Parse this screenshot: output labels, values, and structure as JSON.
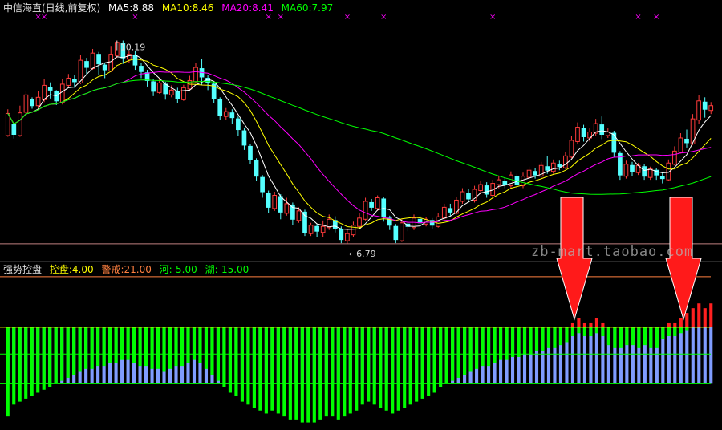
{
  "header": {
    "title": "中信海直(日线,前复权)",
    "ma5": "MA5:8.88",
    "ma10": "MA10:8.46",
    "ma20": "MA20:8.41",
    "ma60": "MA60:7.97",
    "colors": {
      "title": "#e0e0e0",
      "ma5": "#ffffff",
      "ma10": "#ffff00",
      "ma20": "#ff00ff",
      "ma60": "#00ff00"
    }
  },
  "indicator_header": {
    "name": "强势控盘",
    "kongpan": "控盘:4.00",
    "jingjie": "警戒:21.00",
    "he": "河:-5.00",
    "hu": "湖:-15.00",
    "colors": {
      "name": "#e0e0e0",
      "kongpan": "#ffff00",
      "jingjie": "#ff8040",
      "he": "#00ff00",
      "hu": "#00ff00"
    }
  },
  "watermark": "zb-mart.taobao.com",
  "chart_data": [
    {
      "type": "candlestick",
      "title": "中信海直(日线,前复权)",
      "annotations": [
        {
          "label": "10.19",
          "kind": "high"
        },
        {
          "label": "6.79",
          "kind": "low"
        }
      ],
      "ylim": [
        6.6,
        10.6
      ],
      "reference_line": 6.79,
      "candles": [
        [
          8.6,
          8.97,
          8.58,
          9.04
        ],
        [
          8.79,
          8.62,
          8.55,
          8.8
        ],
        [
          8.6,
          8.98,
          8.58,
          9.1
        ],
        [
          8.99,
          9.28,
          8.97,
          9.35
        ],
        [
          9.2,
          9.1,
          9.05,
          9.24
        ],
        [
          9.1,
          9.24,
          9.06,
          9.34
        ],
        [
          9.2,
          9.44,
          9.16,
          9.55
        ],
        [
          9.4,
          9.36,
          9.22,
          9.49
        ],
        [
          9.34,
          9.18,
          9.11,
          9.36
        ],
        [
          9.15,
          9.46,
          9.12,
          9.55
        ],
        [
          9.44,
          9.56,
          9.4,
          9.63
        ],
        [
          9.54,
          9.5,
          9.4,
          9.61
        ],
        [
          9.48,
          9.86,
          9.46,
          9.95
        ],
        [
          9.84,
          9.74,
          9.62,
          9.9
        ],
        [
          9.72,
          9.98,
          9.7,
          10.05
        ],
        [
          9.96,
          9.8,
          9.62,
          10.0
        ],
        [
          9.78,
          9.7,
          9.56,
          9.82
        ],
        [
          9.68,
          9.96,
          9.66,
          10.1
        ],
        [
          9.94,
          10.16,
          9.9,
          10.19
        ],
        [
          10.14,
          9.9,
          9.8,
          10.19
        ],
        [
          9.88,
          9.96,
          9.82,
          10.02
        ],
        [
          9.94,
          9.78,
          9.7,
          10.02
        ],
        [
          9.76,
          9.67,
          9.56,
          9.82
        ],
        [
          9.65,
          9.52,
          9.42,
          9.7
        ],
        [
          9.5,
          9.34,
          9.26,
          9.55
        ],
        [
          9.32,
          9.48,
          9.3,
          9.56
        ],
        [
          9.46,
          9.3,
          9.2,
          9.5
        ],
        [
          9.28,
          9.36,
          9.24,
          9.44
        ],
        [
          9.34,
          9.22,
          9.15,
          9.4
        ],
        [
          9.2,
          9.4,
          9.18,
          9.45
        ],
        [
          9.38,
          9.52,
          9.34,
          9.6
        ],
        [
          9.5,
          9.74,
          9.48,
          9.82
        ],
        [
          9.72,
          9.58,
          9.44,
          9.88
        ],
        [
          9.56,
          9.48,
          9.36,
          9.62
        ],
        [
          9.46,
          9.22,
          9.14,
          9.5
        ],
        [
          9.2,
          8.94,
          8.86,
          9.24
        ],
        [
          8.92,
          9.0,
          8.86,
          9.06
        ],
        [
          8.98,
          8.9,
          8.8,
          9.04
        ],
        [
          8.88,
          8.7,
          8.6,
          8.92
        ],
        [
          8.68,
          8.44,
          8.36,
          8.72
        ],
        [
          8.42,
          8.2,
          8.12,
          8.46
        ],
        [
          8.18,
          7.92,
          7.84,
          8.22
        ],
        [
          7.9,
          7.66,
          7.56,
          7.94
        ],
        [
          7.64,
          7.4,
          7.3,
          7.68
        ],
        [
          7.38,
          7.6,
          7.34,
          7.66
        ],
        [
          7.58,
          7.32,
          7.2,
          7.62
        ],
        [
          7.3,
          7.46,
          7.26,
          7.56
        ],
        [
          7.44,
          7.2,
          7.1,
          7.48
        ],
        [
          7.18,
          7.34,
          7.14,
          7.4
        ],
        [
          7.32,
          6.98,
          6.92,
          7.36
        ],
        [
          6.96,
          7.1,
          6.92,
          7.14
        ],
        [
          7.08,
          7.0,
          6.9,
          7.12
        ],
        [
          6.98,
          7.08,
          6.9,
          7.18
        ],
        [
          7.06,
          7.2,
          7.02,
          7.28
        ],
        [
          7.18,
          7.05,
          6.98,
          7.25
        ],
        [
          7.03,
          6.86,
          6.8,
          7.08
        ],
        [
          6.84,
          6.96,
          6.79,
          7.04
        ],
        [
          6.94,
          7.1,
          6.9,
          7.16
        ],
        [
          7.08,
          7.22,
          7.04,
          7.3
        ],
        [
          7.2,
          7.5,
          7.18,
          7.56
        ],
        [
          7.48,
          7.4,
          7.34,
          7.54
        ],
        [
          7.38,
          7.56,
          7.34,
          7.6
        ],
        [
          7.54,
          7.24,
          7.16,
          7.58
        ],
        [
          7.22,
          7.1,
          7.02,
          7.26
        ],
        [
          7.08,
          6.86,
          6.8,
          7.12
        ],
        [
          6.84,
          7.14,
          6.82,
          7.2
        ],
        [
          7.12,
          7.08,
          7.0,
          7.16
        ],
        [
          7.06,
          7.22,
          7.02,
          7.28
        ],
        [
          7.2,
          7.14,
          7.08,
          7.26
        ],
        [
          7.12,
          7.2,
          7.08,
          7.24
        ],
        [
          7.18,
          7.1,
          7.04,
          7.22
        ],
        [
          7.08,
          7.24,
          7.06,
          7.3
        ],
        [
          7.22,
          7.4,
          7.2,
          7.46
        ],
        [
          7.38,
          7.32,
          7.26,
          7.46
        ],
        [
          7.3,
          7.52,
          7.28,
          7.58
        ],
        [
          7.5,
          7.66,
          7.46,
          7.72
        ],
        [
          7.64,
          7.54,
          7.48,
          7.7
        ],
        [
          7.52,
          7.7,
          7.48,
          7.76
        ],
        [
          7.68,
          7.78,
          7.62,
          7.84
        ],
        [
          7.76,
          7.62,
          7.56,
          7.82
        ],
        [
          7.6,
          7.8,
          7.58,
          7.86
        ],
        [
          7.78,
          7.86,
          7.72,
          7.92
        ],
        [
          7.84,
          7.78,
          7.72,
          7.9
        ],
        [
          7.76,
          7.94,
          7.72,
          8.0
        ],
        [
          7.92,
          7.78,
          7.7,
          7.96
        ],
        [
          7.76,
          7.92,
          7.72,
          7.98
        ],
        [
          7.9,
          8.02,
          7.86,
          8.08
        ],
        [
          8.0,
          7.94,
          7.88,
          8.06
        ],
        [
          7.92,
          8.1,
          7.88,
          8.16
        ],
        [
          8.08,
          8.02,
          7.96,
          8.26
        ],
        [
          8.0,
          8.14,
          7.96,
          8.2
        ],
        [
          8.12,
          8.08,
          8.02,
          8.18
        ],
        [
          8.06,
          8.26,
          8.04,
          8.32
        ],
        [
          8.24,
          8.52,
          8.22,
          8.6
        ],
        [
          8.5,
          8.74,
          8.46,
          8.82
        ],
        [
          8.72,
          8.58,
          8.5,
          8.78
        ],
        [
          8.56,
          8.66,
          8.5,
          8.72
        ],
        [
          8.64,
          8.8,
          8.6,
          8.88
        ],
        [
          8.78,
          8.62,
          8.54,
          8.92
        ],
        [
          8.6,
          8.66,
          8.56,
          8.72
        ],
        [
          8.64,
          8.32,
          8.24,
          8.68
        ],
        [
          8.3,
          7.94,
          7.86,
          8.34
        ],
        [
          7.92,
          8.12,
          7.88,
          8.18
        ],
        [
          8.1,
          8.0,
          7.92,
          8.16
        ],
        [
          7.98,
          8.1,
          7.94,
          8.14
        ],
        [
          8.08,
          7.92,
          7.86,
          8.12
        ],
        [
          7.9,
          8.04,
          7.86,
          8.08
        ],
        [
          8.02,
          7.94,
          7.86,
          8.06
        ],
        [
          7.92,
          7.88,
          7.8,
          7.98
        ],
        [
          7.86,
          8.14,
          7.84,
          8.2
        ],
        [
          8.12,
          8.34,
          8.1,
          8.42
        ],
        [
          8.32,
          8.56,
          8.3,
          8.64
        ],
        [
          8.54,
          8.48,
          8.4,
          8.7
        ],
        [
          8.46,
          8.88,
          8.44,
          8.96
        ],
        [
          8.86,
          9.18,
          8.8,
          9.28
        ],
        [
          9.16,
          9.04,
          8.9,
          9.24
        ],
        [
          9.02,
          9.1,
          8.96,
          9.16
        ]
      ],
      "ma_series": [
        {
          "name": "MA5",
          "period": 5,
          "color": "#ffffff"
        },
        {
          "name": "MA10",
          "period": 10,
          "color": "#ffff00"
        },
        {
          "name": "MA20",
          "period": 20,
          "color": "#ff00ff"
        },
        {
          "name": "MA60",
          "period": 60,
          "color": "#00ff00"
        }
      ],
      "signal_marks": {
        "symbol": "×",
        "color": "#ff00ff",
        "indices": [
          5,
          6,
          21,
          43,
          45,
          56,
          62,
          80,
          104,
          107
        ]
      }
    },
    {
      "type": "bar",
      "title": "强势控盘",
      "ylim": [
        -30,
        25
      ],
      "reference_lines": [
        {
          "name": "警戒",
          "value": 21.0,
          "color": "#ff8040"
        },
        {
          "name": "控盘",
          "value": 4.0,
          "color": "#ffff00"
        },
        {
          "name": "河",
          "value": -5.0,
          "color": "#00ff00"
        },
        {
          "name": "湖",
          "value": -15.0,
          "color": "#00ff00"
        }
      ],
      "series_colors": {
        "positive": "#ff2020",
        "negative": "#00ff00",
        "base": "#7f9cff"
      },
      "values": [
        -26,
        -22,
        -21,
        -20,
        -19,
        -18,
        -17,
        -16,
        -15,
        -14,
        -13,
        -12,
        -11,
        -10,
        -10,
        -9,
        -9,
        -8,
        -8,
        -7,
        -7,
        -8,
        -9,
        -9,
        -10,
        -10,
        -11,
        -10,
        -9,
        -9,
        -8,
        -7,
        -8,
        -10,
        -12,
        -14,
        -16,
        -18,
        -19,
        -21,
        -22,
        -23,
        -24,
        -25,
        -24,
        -25,
        -26,
        -27,
        -27,
        -28,
        -28,
        -28,
        -27,
        -26,
        -26,
        -27,
        -26,
        -25,
        -24,
        -22,
        -21,
        -22,
        -23,
        -24,
        -25,
        -24,
        -23,
        -22,
        -21,
        -20,
        -19,
        -18,
        -16,
        -15,
        -14,
        -13,
        -12,
        -11,
        -10,
        -9,
        -9,
        -8,
        -7,
        -7,
        -6,
        -6,
        -5,
        -5,
        -4,
        -4,
        -3,
        -3,
        -2,
        -1,
        1,
        2,
        1,
        1,
        2,
        1,
        -2,
        -3,
        -3,
        -2,
        -2,
        -3,
        -2,
        -3,
        -3,
        0,
        1,
        1,
        2,
        3,
        4,
        5,
        4,
        5
      ]
    }
  ]
}
